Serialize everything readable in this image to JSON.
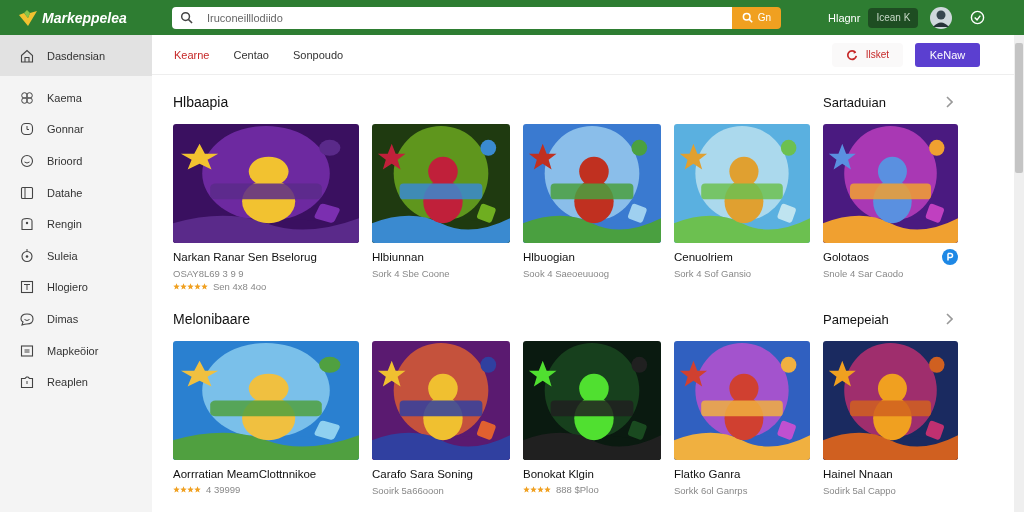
{
  "header": {
    "logo": "Markeppelea",
    "search": {
      "placeholder": "Iruconeilllodiido",
      "button": "Gn"
    },
    "user_label": "Hlagnr",
    "pill": "Icean  K"
  },
  "sidebar": {
    "items": [
      {
        "label": "Dasdensian",
        "selected": true
      },
      {
        "label": "Kaema",
        "selected": false
      },
      {
        "label": "Gonnar",
        "selected": false
      },
      {
        "label": "Brioord",
        "selected": false
      },
      {
        "label": "Datahe",
        "selected": false
      },
      {
        "label": "Rengin",
        "selected": false
      },
      {
        "label": "Suleia",
        "selected": false
      },
      {
        "label": "Hlogiero",
        "selected": false
      },
      {
        "label": "Dimas",
        "selected": false
      },
      {
        "label": "Mapkeöior",
        "selected": false
      },
      {
        "label": "Reaplen",
        "selected": false
      }
    ]
  },
  "tabs": [
    {
      "label": "Kearne",
      "selected": true
    },
    {
      "label": "Centao",
      "selected": false
    },
    {
      "label": "Sonpoudo",
      "selected": false
    }
  ],
  "actions": {
    "secondary": "Ilsket",
    "primary": "KeNaw"
  },
  "sections": [
    {
      "title": "Hlbaapia",
      "link": "Sartaduian",
      "cards": [
        {
          "title": "Narkan Ranar Sen Bselorug",
          "subtitle": "OSAY8L69 3 9 9",
          "stars": 5,
          "meta": "Sen 4x8 4oo",
          "badge": false
        },
        {
          "title": "Hlbiunnan",
          "subtitle": "Sork 4 Sbe Coone",
          "badge": false
        },
        {
          "title": "Hlbuogian",
          "subtitle": "Sook 4 Saeoeuuoog",
          "badge": false
        },
        {
          "title": "Cenuolriem",
          "subtitle": "Sork 4 Sof Gansio",
          "badge": false
        },
        {
          "title": "Golotaos",
          "subtitle": "Snole 4 Sar Caodo",
          "badge": true
        }
      ]
    },
    {
      "title": "Melonibaare",
      "link": "Pamepeiah",
      "cards": [
        {
          "title": "Aorrratian MeamClottnnikoe",
          "stars": 4,
          "meta": "4 39999",
          "badge": false
        },
        {
          "title": "Carafo Sara Soning",
          "subtitle": "Sooirk 5a66ooon",
          "badge": false
        },
        {
          "title": "Bonokat Klgin",
          "stars": 4,
          "meta": "888 $Ploo",
          "badge": false
        },
        {
          "title": "Flatko Ganra",
          "subtitle": "Sorkk 6ol Ganrps",
          "badge": false
        },
        {
          "title": "Hainel Nnaan",
          "subtitle": "Sodirk 5al Cappo",
          "badge": false
        }
      ]
    }
  ]
}
